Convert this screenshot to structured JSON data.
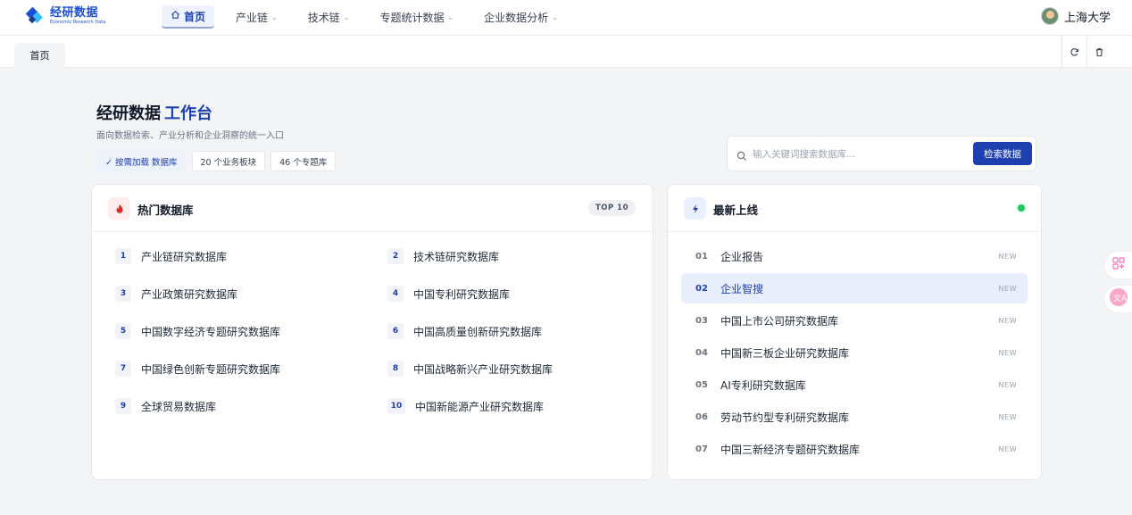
{
  "app": {
    "logo_title": "经研数据",
    "logo_subtitle": "Economic Research Data",
    "brand_color": "#1e40af"
  },
  "nav": {
    "items": [
      {
        "label": "首页",
        "active": true,
        "icon": "home-icon"
      },
      {
        "label": "产业链",
        "has_dropdown": true
      },
      {
        "label": "技术链",
        "has_dropdown": true
      },
      {
        "label": "专题统计数据",
        "has_dropdown": true
      },
      {
        "label": "企业数据分析",
        "has_dropdown": true
      }
    ]
  },
  "user": {
    "name": "上海大学"
  },
  "tabs": {
    "items": [
      {
        "label": "首页"
      }
    ],
    "tools": [
      "refresh-icon",
      "trash-icon"
    ]
  },
  "workspace": {
    "title_main": "经研数据",
    "title_accent": "工作台",
    "subtitle": "面向数据检索、产业分析和企业洞察的统一入口",
    "chips": [
      {
        "label": "✓ 按需加载 数据库",
        "primary": true
      },
      {
        "label": "20 个业务板块"
      },
      {
        "label": "46 个专题库"
      }
    ]
  },
  "search": {
    "placeholder": "输入关键词搜索数据库...",
    "value": "",
    "button_label": "检索数据"
  },
  "hot": {
    "title": "热门数据库",
    "badge": "TOP 10",
    "items": [
      {
        "num": "1",
        "label": "产业链研究数据库"
      },
      {
        "num": "2",
        "label": "技术链研究数据库"
      },
      {
        "num": "3",
        "label": "产业政策研究数据库"
      },
      {
        "num": "4",
        "label": "中国专利研究数据库"
      },
      {
        "num": "5",
        "label": "中国数字经济专题研究数据库"
      },
      {
        "num": "6",
        "label": "中国高质量创新研究数据库"
      },
      {
        "num": "7",
        "label": "中国绿色创新专题研究数据库"
      },
      {
        "num": "8",
        "label": "中国战略新兴产业研究数据库"
      },
      {
        "num": "9",
        "label": "全球贸易数据库"
      },
      {
        "num": "10",
        "label": "中国新能源产业研究数据库"
      }
    ]
  },
  "latest": {
    "title": "最新上线",
    "status_color": "#22c55e",
    "items": [
      {
        "num": "01",
        "label": "企业报告",
        "tag": "NEW"
      },
      {
        "num": "02",
        "label": "企业智搜",
        "tag": "NEW",
        "active": true
      },
      {
        "num": "03",
        "label": "中国上市公司研究数据库",
        "tag": "NEW"
      },
      {
        "num": "04",
        "label": "中国新三板企业研究数据库",
        "tag": "NEW"
      },
      {
        "num": "05",
        "label": "AI专利研究数据库",
        "tag": "NEW"
      },
      {
        "num": "06",
        "label": "劳动节约型专利研究数据库",
        "tag": "NEW"
      },
      {
        "num": "07",
        "label": "中国三新经济专题研究数据库",
        "tag": "NEW"
      }
    ]
  },
  "floating": [
    "apps-icon",
    "translate-icon"
  ]
}
